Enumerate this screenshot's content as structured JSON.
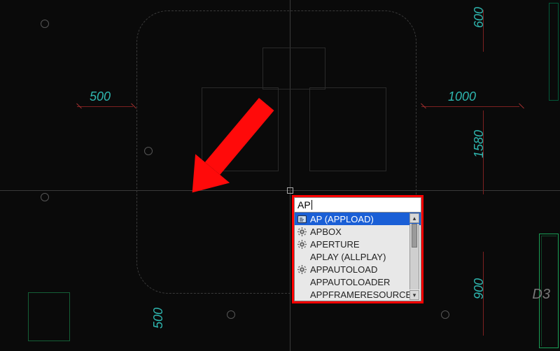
{
  "drawing": {
    "dimensions": {
      "top_left": "500",
      "top_right": "1000",
      "right_upper": "600",
      "right_mid": "1580",
      "right_lower": "900",
      "bottom": "500"
    },
    "grid_label": "D3"
  },
  "command": {
    "input_value": "AP",
    "suggestions": [
      {
        "label": "AP (APPLOAD)",
        "icon": "lisp-icon",
        "selected": true
      },
      {
        "label": "APBOX",
        "icon": "gear-icon",
        "selected": false
      },
      {
        "label": "APERTURE",
        "icon": "gear-icon",
        "selected": false
      },
      {
        "label": "APLAY (ALLPLAY)",
        "icon": "none",
        "selected": false
      },
      {
        "label": "APPAUTOLOAD",
        "icon": "gear-icon",
        "selected": false
      },
      {
        "label": "APPAUTOLOADER",
        "icon": "none",
        "selected": false
      },
      {
        "label": "APPFRAMERESOURCES",
        "icon": "none",
        "selected": false
      }
    ]
  }
}
